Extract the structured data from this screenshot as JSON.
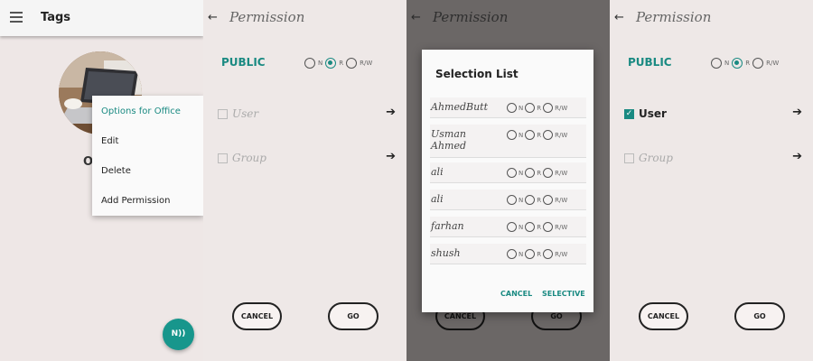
{
  "tags_screen": {
    "title": "Tags",
    "avatar_name": "Of",
    "context_menu": [
      "Options for Office",
      "Edit",
      "Delete",
      "Add Permission"
    ],
    "fab_label": "N))"
  },
  "permission_screen": {
    "title": "Permission",
    "public_label": "PUBLIC",
    "radio_labels": [
      "N",
      "R",
      "R/W"
    ],
    "user_label": "User",
    "group_label": "Group",
    "cancel_label": "CANCEL",
    "go_label": "GO"
  },
  "selection_dialog": {
    "title": "Selection List",
    "items": [
      "AhmedButt",
      "Usman\nAhmed",
      "ali",
      "ali",
      "farhan",
      "shush"
    ],
    "cancel": "CANCEL",
    "selective": "SELECTIVE"
  },
  "colors": {
    "accent": "#1a8a82",
    "fab": "#17968c"
  },
  "icons": [
    "hamburger-icon",
    "back-arrow-icon",
    "right-arrow-icon",
    "nfc-icon",
    "check-icon"
  ]
}
